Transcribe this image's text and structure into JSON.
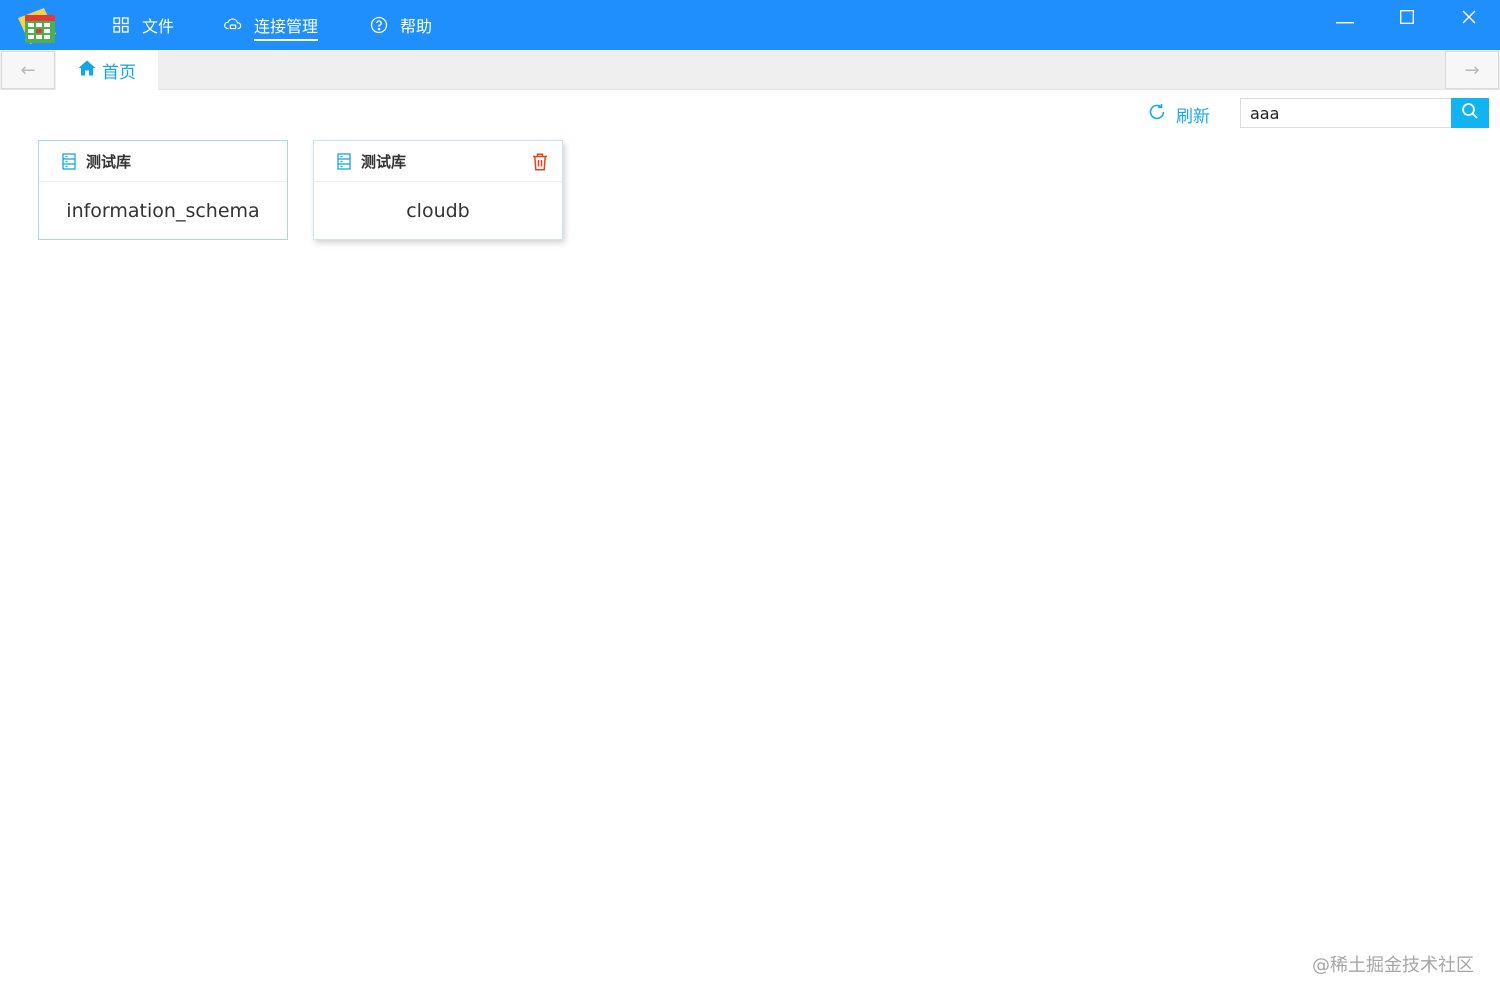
{
  "menu": {
    "items": [
      {
        "label": "文件",
        "icon": "grid-icon"
      },
      {
        "label": "连接管理",
        "icon": "cloud-link-icon",
        "active": true
      },
      {
        "label": "帮助",
        "icon": "question-circle-icon"
      }
    ]
  },
  "window_controls": {
    "minimize": "minimize-icon",
    "maximize": "maximize-icon",
    "close": "close-icon"
  },
  "tabs": {
    "prev_arrow": "←",
    "next_arrow": "→",
    "home_label": "首页"
  },
  "toolbar": {
    "refresh_label": "刷新",
    "search_value": "aaa"
  },
  "cards": [
    {
      "tag": "测试库",
      "name": "information_schema",
      "deletable": false
    },
    {
      "tag": "测试库",
      "name": "cloudb",
      "deletable": true
    }
  ],
  "watermark": "@稀土掘金技术社区",
  "colors": {
    "titlebar": "#1e8ffc",
    "accent": "#11a6e8",
    "delete": "#e8401c"
  }
}
